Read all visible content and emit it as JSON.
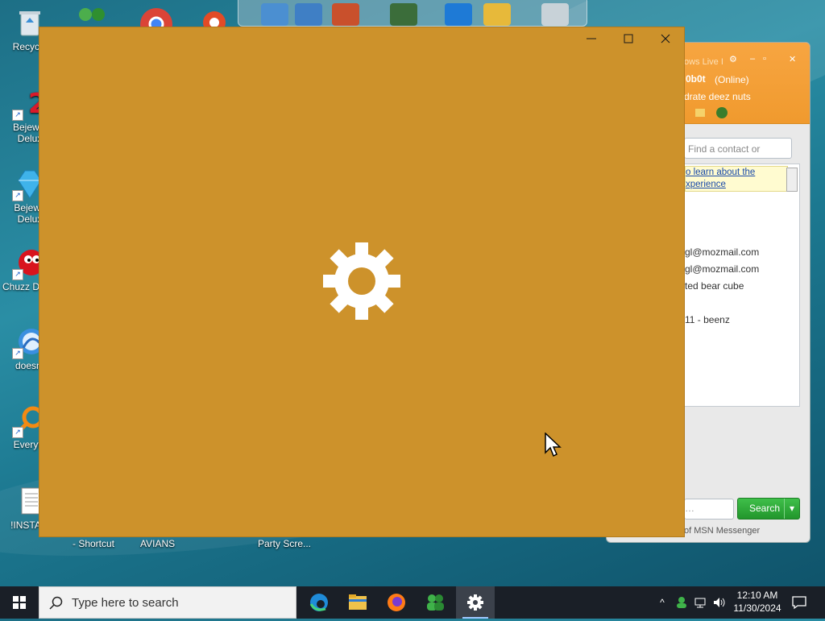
{
  "desktop": {
    "icons": [
      {
        "label": "Recycle",
        "name": "recycle-bin"
      },
      {
        "label": "Bejewel Delux",
        "name": "bejeweled-2-deluxe"
      },
      {
        "label": "Bejewe Delux",
        "name": "bejeweled-deluxe"
      },
      {
        "label": "Chuzz Delux",
        "name": "chuzzle-deluxe"
      },
      {
        "label": "doesnt",
        "name": "doesnt"
      },
      {
        "label": "Everyth",
        "name": "everything"
      },
      {
        "label": "!INSTALI",
        "name": "install"
      }
    ],
    "bottom_labels": [
      "- Shortcut",
      "AVIANS",
      "Party Scre..."
    ]
  },
  "messenger": {
    "title": "ows Live I",
    "username": "0b0t",
    "status": "(Online)",
    "personal_message": "ydrate deez nuts",
    "search_placeholder": "Find a contact or numbe",
    "banner_line1": "o learn about the",
    "banner_line2": "xperience",
    "contacts": [
      "gl@mozmail.com",
      "gl@mozmail.com",
      "ted bear cube",
      "11 - beenz"
    ],
    "search_button": "Search",
    "footer": "of MSN Messenger"
  },
  "settings_window": {
    "minimize": "—",
    "maximize": "☐",
    "close": "✕",
    "background": "#cd922b"
  },
  "taskbar": {
    "search_placeholder": "Type here to search",
    "time": "12:10 AM",
    "date": "11/30/2024",
    "apps": [
      "edge-icon",
      "file-explorer-icon",
      "firefox-icon",
      "messenger-icon",
      "settings-icon"
    ]
  }
}
